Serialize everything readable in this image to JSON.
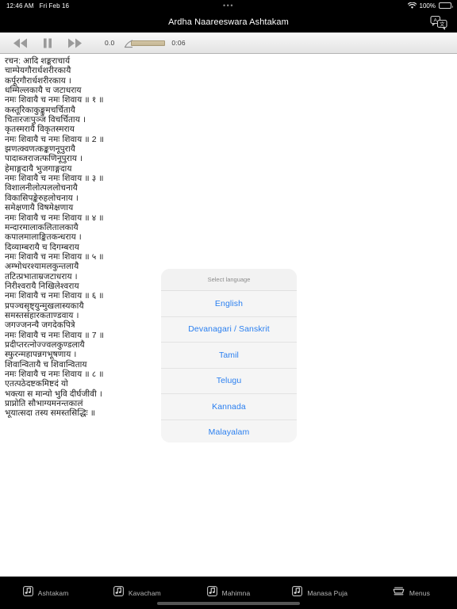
{
  "status_bar": {
    "time": "12:46 AM",
    "date": "Fri Feb 16",
    "center_dots": "•••",
    "battery_percent": "100%",
    "wifi_icon": "wifi-icon",
    "battery_icon": "battery-icon"
  },
  "nav_bar": {
    "title": "Ardha Naareeswara Ashtakam",
    "translate_icon": "translate-icon"
  },
  "toolbar": {
    "rewind_icon": "rewind-icon",
    "pause_icon": "pause-icon",
    "forward_icon": "fast-forward-icon",
    "rate_value": "0.0",
    "elapsed_time": "0:06",
    "slider_icon": "volume-slider-knob-icon"
  },
  "content": {
    "lines": [
      "रचन: आदि शङ्कराचार्य",
      "चाम्पेयगौरार्धशरीरकायै",
      "कर्पूरगौरार्धशरीरकाय ।",
      "धम्मिल्लकायै च जटाधराय",
      "नमः शिवायै च नमः शिवाय ॥ १ ॥",
      "कस्तूरिकाकुङ्कुमचर्चितायै",
      "चितारजःपुञ्ज विचर्चिताय ।",
      "कृतस्मरायै विकृतस्मराय",
      "नमः शिवायै च नमः शिवाय ॥ 2 ॥",
      "झणत्क्वणत्कङ्कणनूपुरायै",
      "पादाब्जराजत्फणिनूपुराय ।",
      "हेमाङ्गदायै भुजगाङ्गदाय",
      "नमः शिवायै च नमः शिवाय ॥ ३ ॥",
      "विशालनीलोत्पललोचनायै",
      "विकासिपङ्केरुहलोचनाय ।",
      "समेक्षणायै विषमेक्षणाय",
      "नमः शिवायै च नमः शिवाय ॥ ४ ॥",
      "मन्दारमालाकलितालकायै",
      "कपालमालाङ्कितकन्धराय ।",
      "दिव्याम्बरायै च दिगम्बराय",
      "नमः शिवायै च नमः शिवाय ॥ ५ ॥",
      "अम्भोधरश्यामलकुन्तलायै",
      "तटित्प्रभाताम्रजटाधराय ।",
      "निरीश्वरायै निखिलेश्वराय",
      "नमः शिवायै च नमः शिवाय ॥ ६ ॥",
      "प्रपञ्चसृष्ट्युन्मुखलास्यकायै",
      "समस्तसंहारकताण्डवाय ।",
      "जगज्जनन्यै जगदेकपित्रे",
      "नमः शिवायै च नमः शिवाय ॥ 7 ॥",
      "प्रदीप्तरत्नोज्ज्वलकुण्डलायै",
      "स्फुरन्महापन्नगभूषणाय ।",
      "शिवान्वितायै च शिवान्विताय",
      "नमः शिवायै च नमः शिवाय ॥ ८ ॥",
      "एतत्पठेदष्टकमिष्टदं यो",
      "भक्त्या स मान्यो भुवि दीर्घजीवी ।",
      "प्राप्नोति सौभाग्यमनन्तकालं",
      "भूयात्सदा तस्य समस्तसिद्धिः ॥"
    ]
  },
  "dialog": {
    "title": "Select language",
    "options": [
      {
        "label": "English"
      },
      {
        "label": "Devanagari / Sanskrit"
      },
      {
        "label": "Tamil"
      },
      {
        "label": "Telugu"
      },
      {
        "label": "Kannada"
      },
      {
        "label": "Malayalam"
      }
    ]
  },
  "tab_bar": {
    "tabs": [
      {
        "label": "Ashtakam",
        "icon": "music-note-icon"
      },
      {
        "label": "Kavacham",
        "icon": "music-note-icon"
      },
      {
        "label": "Mahimna",
        "icon": "music-note-icon"
      },
      {
        "label": "Manasa Puja",
        "icon": "music-note-icon"
      },
      {
        "label": "Menus",
        "icon": "tray-icon"
      }
    ]
  },
  "colors": {
    "accent_blue": "#2a7ff0",
    "chrome_black": "#000000",
    "dialog_bg": "#f2f2f2",
    "slider_track": "#cabb99"
  }
}
